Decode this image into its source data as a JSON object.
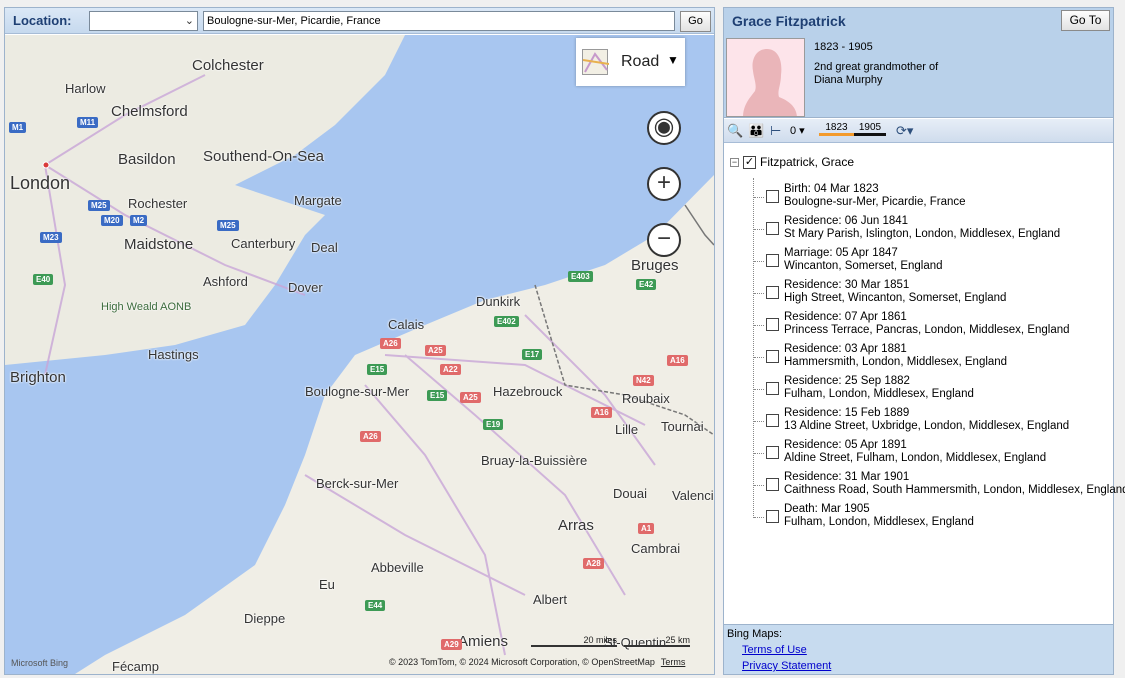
{
  "location_bar": {
    "label": "Location:",
    "selected": "",
    "address": "Boulogne-sur-Mer, Picardie, France",
    "go_label": "Go"
  },
  "map": {
    "style_label": "Road",
    "credit": "© 2023 TomTom, © 2024 Microsoft Corporation, © OpenStreetMap",
    "terms": "Terms",
    "logo": "Microsoft Bing",
    "scale_miles": "20 miles",
    "scale_km": "25 km",
    "places": [
      {
        "name": "Colchester",
        "size": "mid"
      },
      {
        "name": "Harlow",
        "size": "sm"
      },
      {
        "name": "Chelmsford",
        "size": "mid"
      },
      {
        "name": "Basildon",
        "size": "mid"
      },
      {
        "name": "Southend-On-Sea",
        "size": "mid"
      },
      {
        "name": "London",
        "size": "big"
      },
      {
        "name": "Rochester",
        "size": "sm"
      },
      {
        "name": "Margate",
        "size": "sm"
      },
      {
        "name": "Maidstone",
        "size": "mid"
      },
      {
        "name": "Canterbury",
        "size": "sm"
      },
      {
        "name": "Deal",
        "size": "sm"
      },
      {
        "name": "Ashford",
        "size": "sm"
      },
      {
        "name": "Dover",
        "size": "sm"
      },
      {
        "name": "High Weald AONB",
        "size": "xs"
      },
      {
        "name": "Hastings",
        "size": "sm"
      },
      {
        "name": "Brighton",
        "size": "mid"
      },
      {
        "name": "Bruges",
        "size": "mid"
      },
      {
        "name": "Dunkirk",
        "size": "sm"
      },
      {
        "name": "Calais",
        "size": "sm"
      },
      {
        "name": "Boulogne-sur-Mer",
        "size": "sm"
      },
      {
        "name": "Hazebrouck",
        "size": "sm"
      },
      {
        "name": "Roubaix",
        "size": "sm"
      },
      {
        "name": "Lille",
        "size": "sm"
      },
      {
        "name": "Tournai",
        "size": "sm"
      },
      {
        "name": "Bruay-la-Buissière",
        "size": "sm"
      },
      {
        "name": "Berck-sur-Mer",
        "size": "sm"
      },
      {
        "name": "Douai",
        "size": "sm"
      },
      {
        "name": "Valenci",
        "size": "sm"
      },
      {
        "name": "Arras",
        "size": "mid"
      },
      {
        "name": "Cambrai",
        "size": "sm"
      },
      {
        "name": "Abbeville",
        "size": "sm"
      },
      {
        "name": "Eu",
        "size": "sm"
      },
      {
        "name": "Albert",
        "size": "sm"
      },
      {
        "name": "Dieppe",
        "size": "sm"
      },
      {
        "name": "Amiens",
        "size": "mid"
      },
      {
        "name": "St-Quentin",
        "size": "sm"
      },
      {
        "name": "Fécamp",
        "size": "sm"
      }
    ],
    "roads": [
      {
        "label": "M1",
        "color": "blue"
      },
      {
        "label": "M11",
        "color": "blue"
      },
      {
        "label": "M25",
        "color": "blue"
      },
      {
        "label": "M20",
        "color": "blue"
      },
      {
        "label": "M2",
        "color": "blue"
      },
      {
        "label": "M25",
        "color": "blue"
      },
      {
        "label": "M23",
        "color": "blue"
      },
      {
        "label": "E40",
        "color": "green"
      },
      {
        "label": "E403",
        "color": "green"
      },
      {
        "label": "E42",
        "color": "green"
      },
      {
        "label": "E402",
        "color": "green"
      },
      {
        "label": "A26",
        "color": "red"
      },
      {
        "label": "A25",
        "color": "red"
      },
      {
        "label": "E17",
        "color": "green"
      },
      {
        "label": "A16",
        "color": "red"
      },
      {
        "label": "E15",
        "color": "green"
      },
      {
        "label": "A22",
        "color": "red"
      },
      {
        "label": "N42",
        "color": "red"
      },
      {
        "label": "E15",
        "color": "green"
      },
      {
        "label": "A25",
        "color": "red"
      },
      {
        "label": "A16",
        "color": "red"
      },
      {
        "label": "A26",
        "color": "red"
      },
      {
        "label": "E19",
        "color": "green"
      },
      {
        "label": "A1",
        "color": "red"
      },
      {
        "label": "A28",
        "color": "red"
      },
      {
        "label": "E44",
        "color": "green"
      },
      {
        "label": "A29",
        "color": "red"
      }
    ]
  },
  "person": {
    "name": "Grace Fitzpatrick",
    "goto_label": "Go To",
    "lifespan": "1823 - 1905",
    "relationship_line1": "2nd great grandmother of",
    "relationship_line2": "Diana Murphy",
    "toolbar": {
      "count": "0",
      "year_start": "1823",
      "year_end": "1905"
    },
    "tree_root": "Fitzpatrick, Grace",
    "events": [
      {
        "title": "Birth: 04 Mar 1823",
        "place": "Boulogne-sur-Mer, Picardie, France"
      },
      {
        "title": "Residence: 06 Jun 1841",
        "place": "St Mary Parish, Islington, London, Middlesex, England"
      },
      {
        "title": "Marriage: 05 Apr 1847",
        "place": "Wincanton, Somerset, England"
      },
      {
        "title": "Residence: 30 Mar 1851",
        "place": "High Street, Wincanton, Somerset, England"
      },
      {
        "title": "Residence: 07 Apr 1861",
        "place": "Princess Terrace, Pancras, London, Middlesex, England"
      },
      {
        "title": "Residence: 03 Apr 1881",
        "place": "Hammersmith, London, Middlesex, England"
      },
      {
        "title": "Residence: 25 Sep 1882",
        "place": "Fulham, London, Middlesex, England"
      },
      {
        "title": "Residence: 15 Feb 1889",
        "place": "13 Aldine Street, Uxbridge, London, Middlesex, England"
      },
      {
        "title": "Residence: 05 Apr 1891",
        "place": "Aldine Street, Fulham, London, Middlesex, England"
      },
      {
        "title": "Residence: 31 Mar 1901",
        "place": "Caithness Road, South Hammersmith, London, Middlesex, England"
      },
      {
        "title": "Death: Mar 1905",
        "place": "Fulham, London, Middlesex, England"
      }
    ]
  },
  "bing_footer": {
    "label": "Bing Maps:",
    "terms_link": "Terms of Use",
    "privacy_link": "Privacy Statement"
  }
}
